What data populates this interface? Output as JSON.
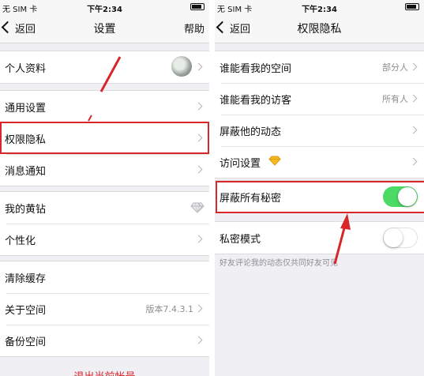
{
  "left": {
    "status": {
      "carrier": "无 SIM 卡",
      "time": "下午2:34"
    },
    "nav": {
      "back": "返回",
      "title": "设置",
      "help": "帮助"
    },
    "items": [
      {
        "label": "个人资料"
      },
      {
        "label": "通用设置"
      },
      {
        "label": "权限隐私"
      },
      {
        "label": "消息通知"
      },
      {
        "label": "我的黄钻"
      },
      {
        "label": "个性化"
      },
      {
        "label": "清除缓存"
      },
      {
        "label": "关于空间",
        "value": "版本7.4.3.1"
      },
      {
        "label": "备份空间"
      }
    ],
    "logout": "退出当前帐号"
  },
  "right": {
    "status": {
      "carrier": "无 SIM 卡",
      "time": "下午2:34"
    },
    "nav": {
      "back": "返回",
      "title": "权限隐私"
    },
    "items": [
      {
        "label": "谁能看我的空间",
        "value": "部分人"
      },
      {
        "label": "谁能看我的访客",
        "value": "所有人"
      },
      {
        "label": "屏蔽他的动态"
      },
      {
        "label": "访问设置"
      },
      {
        "label": "屏蔽所有秘密",
        "toggle": true
      },
      {
        "label": "私密模式",
        "toggle": false
      }
    ],
    "hint": "好友评论我的动态仅共同好友可见"
  },
  "colors": {
    "accent_red": "#d8262b",
    "toggle_on": "#4cd964",
    "background": "#efeff4"
  }
}
